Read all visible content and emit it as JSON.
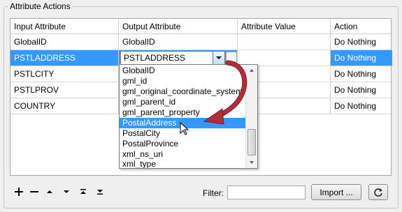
{
  "group": {
    "title": "Attribute Actions"
  },
  "table": {
    "columns": [
      "Input Attribute",
      "Output Attribute",
      "Attribute Value",
      "Action"
    ],
    "rows": [
      {
        "input": "GlobalID",
        "output": "GlobalID",
        "value": "",
        "action": "Do Nothing"
      },
      {
        "input": "PSTLADDRESS",
        "output": "PSTLADDRESS",
        "value": "",
        "action": "Do Nothing"
      },
      {
        "input": "PSTLCITY",
        "output": "",
        "value": "",
        "action": "Do Nothing"
      },
      {
        "input": "PSTLPROV",
        "output": "",
        "value": "",
        "action": "Do Nothing"
      },
      {
        "input": "COUNTRY",
        "output": "",
        "value": "",
        "action": "Do Nothing"
      }
    ],
    "selected_row_index": 1
  },
  "dropdown": {
    "items": [
      "GlobalID",
      "gml_id",
      "gml_original_coordinate_system",
      "gml_parent_id",
      "gml_parent_property",
      "PostalAddress",
      "PostalCity",
      "PostalProvince",
      "xml_ns_uri",
      "xml_type"
    ],
    "highlighted": "PostalAddress"
  },
  "toolbar": {
    "icons": [
      "plus-icon",
      "minus-icon",
      "move-up-icon",
      "move-down-icon",
      "move-top-icon",
      "move-bottom-icon"
    ]
  },
  "filter": {
    "label": "Filter:",
    "value": ""
  },
  "buttons": {
    "import": "Import ...",
    "refresh_icon": "refresh-icon"
  },
  "colors": {
    "selection": "#3399ff",
    "arrow": "#b0303a"
  }
}
